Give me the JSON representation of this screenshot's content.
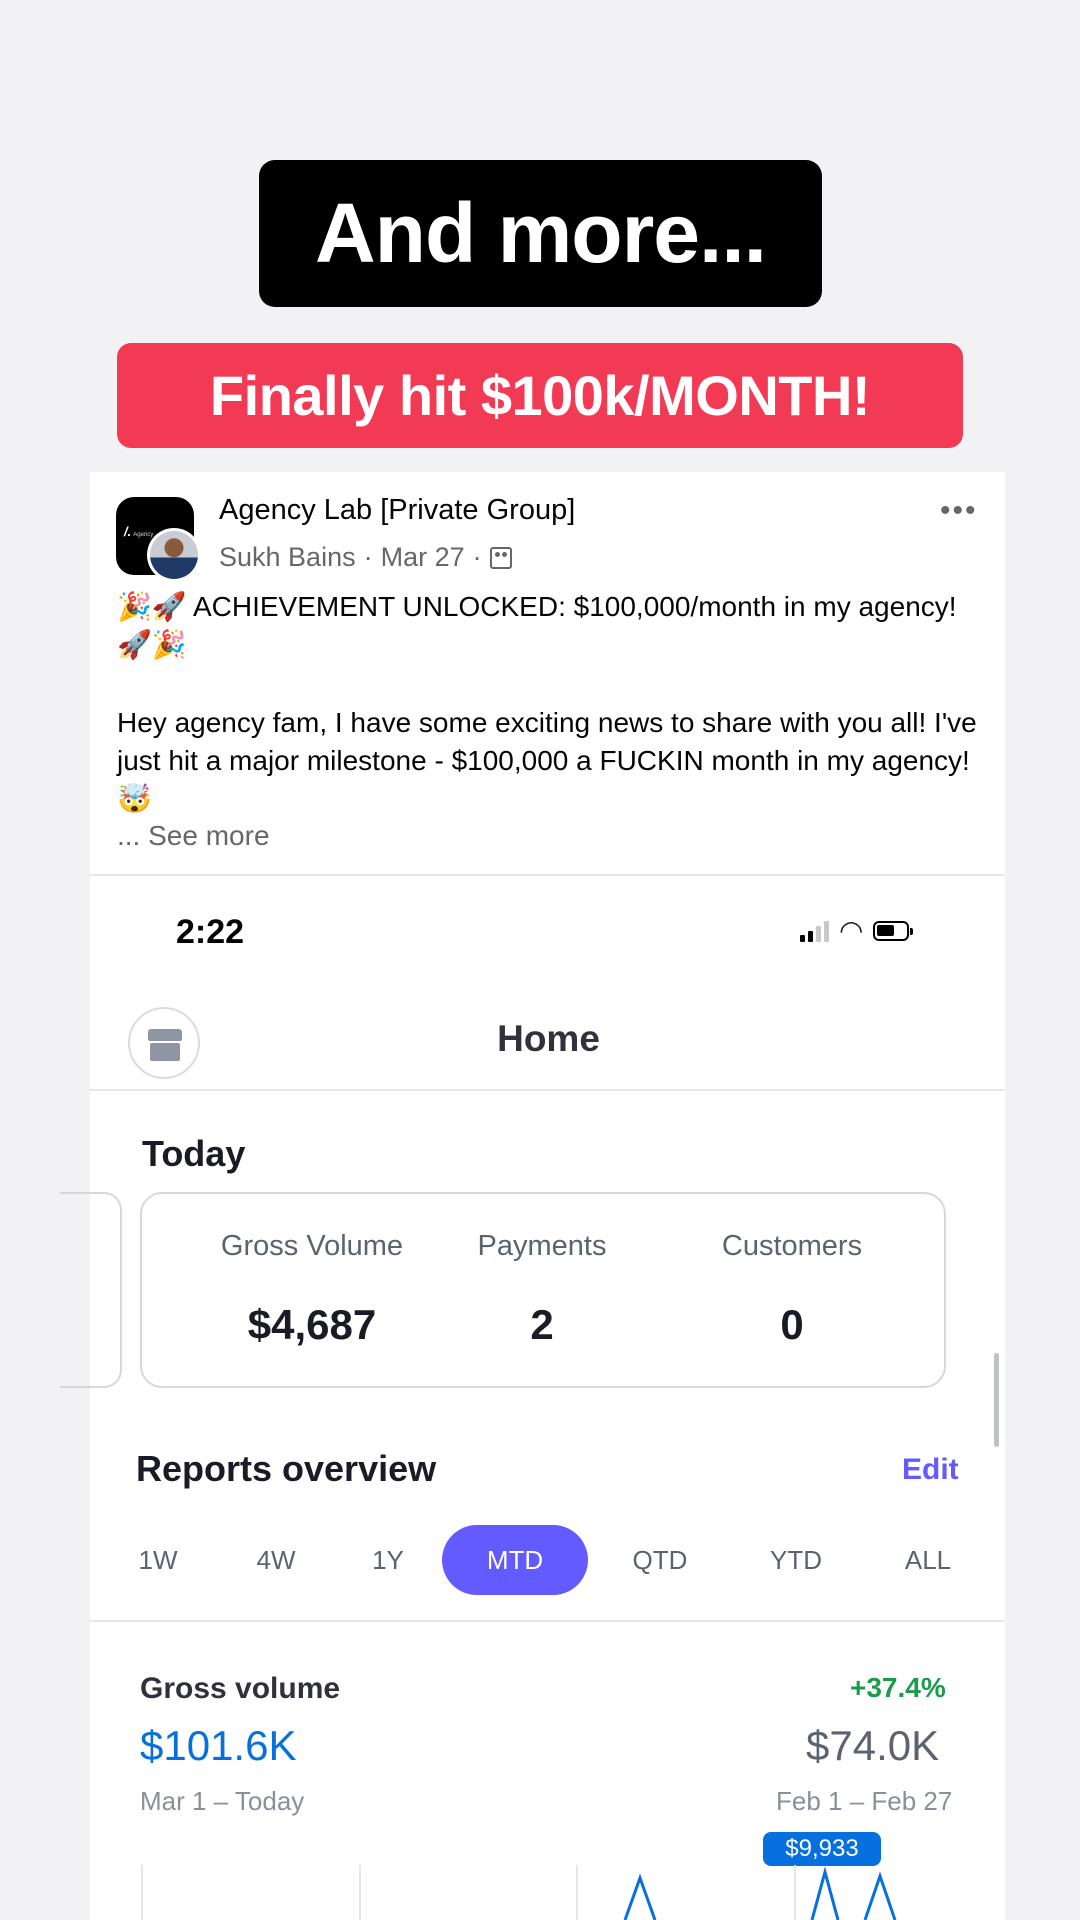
{
  "story": {
    "headline": "And more...",
    "banner": "Finally hit $100k/MONTH!"
  },
  "post": {
    "group_name": "Agency Lab [Private Group]",
    "group_logo_text": "Agency",
    "author": "Sukh Bains",
    "date": "Mar 27",
    "separator": "·",
    "more_icon": "more-dots-icon",
    "line1_emoji_start": "🎉🚀",
    "line1_text": " ACHIEVEMENT UNLOCKED: $100,000/month in my agency! ",
    "line1_emoji_end": "🚀🎉",
    "paragraph": "Hey agency fam, I have some exciting news to share with you all! I've just hit a major milestone - $100,000 a FUCKIN month in my agency! ",
    "paragraph_emoji": "🤯",
    "see_more": "... See more"
  },
  "phone": {
    "time": "2:22",
    "nav_title": "Home",
    "today": {
      "title": "Today",
      "stats": [
        {
          "label": "Gross Volume",
          "value": "$4,687"
        },
        {
          "label": "Payments",
          "value": "2"
        },
        {
          "label": "Customers",
          "value": "0"
        }
      ]
    },
    "reports": {
      "title": "Reports overview",
      "edit": "Edit",
      "tabs": [
        "1W",
        "4W",
        "1Y",
        "MTD",
        "QTD",
        "YTD",
        "ALL"
      ],
      "active_tab": "MTD"
    },
    "gross_volume": {
      "label": "Gross volume",
      "change": "+37.4%",
      "value": "$101.6K",
      "range": "Mar 1 – Today",
      "previous_value": "$74.0K",
      "previous_range": "Feb 1 – Feb 27",
      "tooltip": "$9,933"
    }
  },
  "colors": {
    "banner_red": "#f23a55",
    "accent_purple": "#635bff",
    "value_blue": "#0570de",
    "positive_green": "#1d9b4c"
  }
}
